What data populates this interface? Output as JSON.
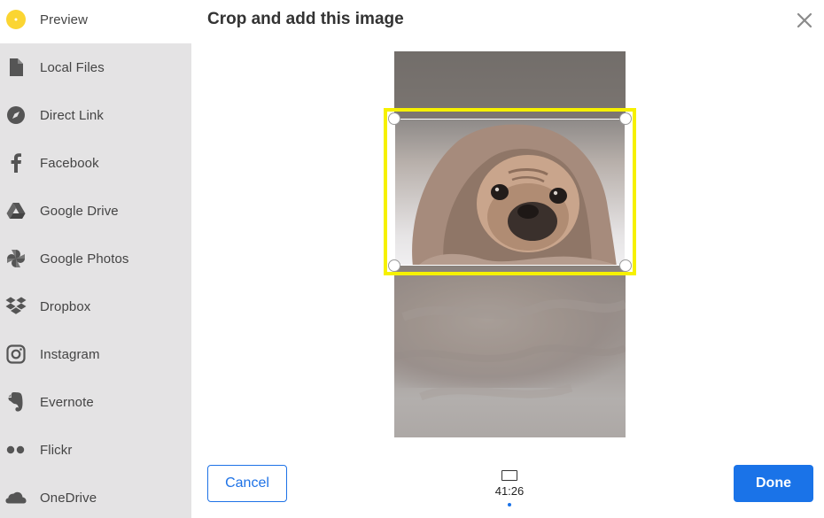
{
  "dialog": {
    "title": "Crop and add this image",
    "close_icon": "close-icon"
  },
  "sidebar": {
    "items": [
      {
        "label": "Preview",
        "icon": "preview-dot-icon",
        "active": true
      },
      {
        "label": "Local Files",
        "icon": "file-icon"
      },
      {
        "label": "Direct Link",
        "icon": "compass-icon"
      },
      {
        "label": "Facebook",
        "icon": "facebook-icon"
      },
      {
        "label": "Google Drive",
        "icon": "google-drive-icon"
      },
      {
        "label": "Google Photos",
        "icon": "google-photos-icon"
      },
      {
        "label": "Dropbox",
        "icon": "dropbox-icon"
      },
      {
        "label": "Instagram",
        "icon": "instagram-icon"
      },
      {
        "label": "Evernote",
        "icon": "evernote-icon"
      },
      {
        "label": "Flickr",
        "icon": "flickr-icon"
      },
      {
        "label": "OneDrive",
        "icon": "onedrive-icon"
      }
    ]
  },
  "crop": {
    "ratio_label": "41:26",
    "ratio_icon": "aspect-ratio-icon"
  },
  "footer": {
    "cancel_label": "Cancel",
    "done_label": "Done"
  },
  "colors": {
    "accent": "#1a73e8",
    "crop_highlight": "#f6f100",
    "preview_dot": "#fbd532",
    "sidebar_bg": "#e4e3e4"
  }
}
